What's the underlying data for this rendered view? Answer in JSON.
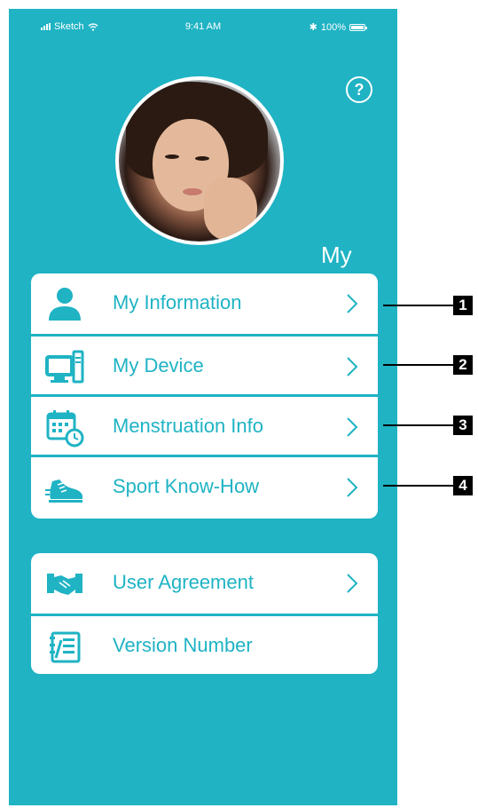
{
  "status_bar": {
    "carrier": "Sketch",
    "time": "9:41 AM",
    "bluetooth": "✱",
    "battery": "100%"
  },
  "header": {
    "help_icon": "?",
    "title": "My"
  },
  "menu_group_1": [
    {
      "label": "My Information",
      "icon": "user-icon"
    },
    {
      "label": "My Device",
      "icon": "computer-icon"
    },
    {
      "label": "Menstruation Info",
      "icon": "calendar-clock-icon"
    },
    {
      "label": "Sport Know-How",
      "icon": "sneaker-icon"
    }
  ],
  "menu_group_2": [
    {
      "label": "User Agreement",
      "icon": "handshake-icon"
    },
    {
      "label": "Version Number",
      "icon": "notebook-icon"
    }
  ],
  "callouts": [
    "1",
    "2",
    "3",
    "4"
  ],
  "colors": {
    "primary": "#1fb3c4",
    "card": "#ffffff"
  }
}
